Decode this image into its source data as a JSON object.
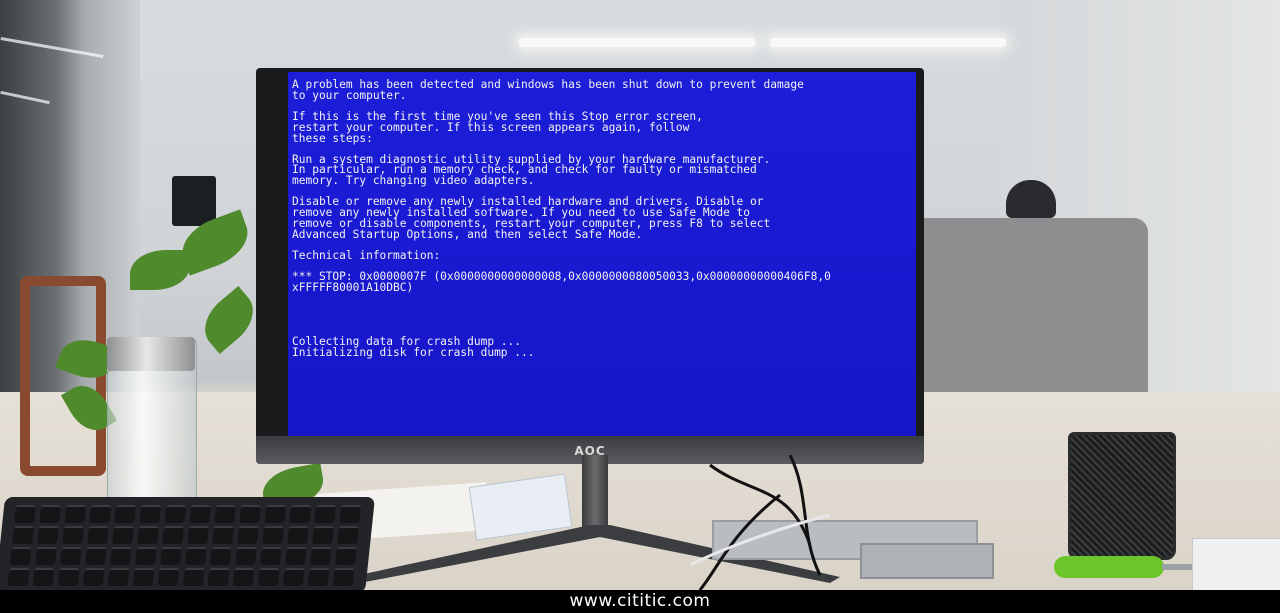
{
  "scene": {
    "description_colors": {
      "bsod_blue": "#1a1adf",
      "bsod_text": "#f2f2f2",
      "footer_bg": "#000000"
    }
  },
  "monitor": {
    "brand": "AOC"
  },
  "bsod": {
    "lines": [
      "A problem has been detected and windows has been shut down to prevent damage\nto your computer.",
      "If this is the first time you've seen this Stop error screen,\nrestart your computer. If this screen appears again, follow\nthese steps:",
      "Run a system diagnostic utility supplied by your hardware manufacturer.\nIn particular, run a memory check, and check for faulty or mismatched\nmemory. Try changing video adapters.",
      "Disable or remove any newly installed hardware and drivers. Disable or\nremove any newly installed software. If you need to use Safe Mode to\nremove or disable components, restart your computer, press F8 to select\nAdvanced Startup Options, and then select Safe Mode.",
      "Technical information:",
      "*** STOP: 0x0000007F (0x0000000000000008,0x0000000080050033,0x00000000000406F8,0\nxFFFFF80001A10DBC)",
      "Collecting data for crash dump ...\nInitializing disk for crash dump ..."
    ]
  },
  "footer": {
    "watermark": "www.cititic.com"
  }
}
